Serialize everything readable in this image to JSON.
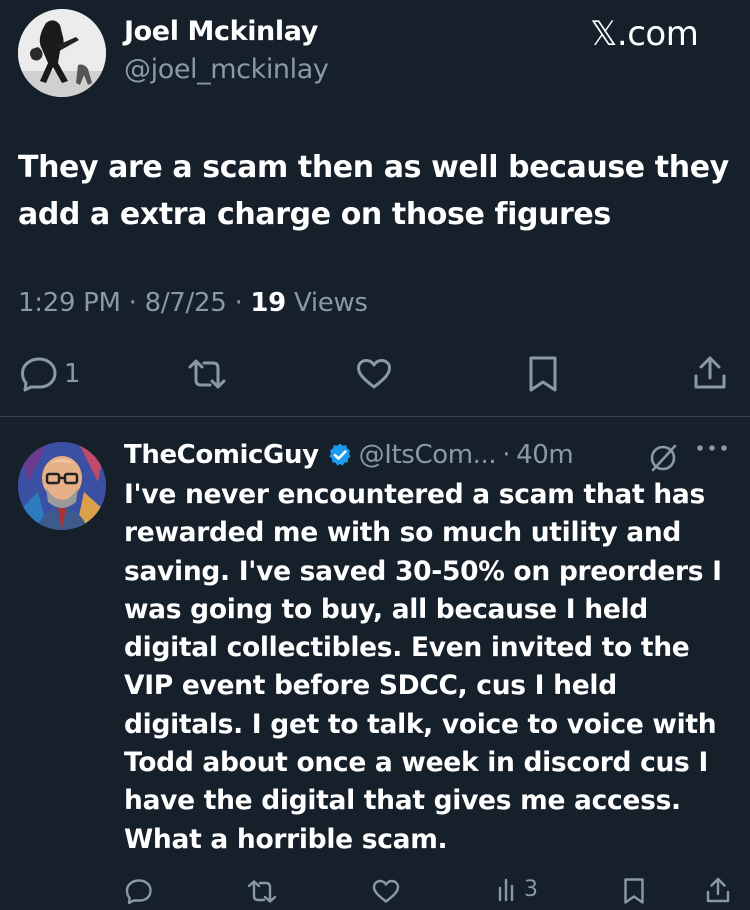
{
  "post": {
    "author_name": "Joel Mckinlay",
    "author_handle": "@joel_mckinlay",
    "brand_x": "𝕏",
    "brand_suffix": ".com",
    "text": "They are a scam then as well because they add a extra charge on those figures",
    "time": "1:29 PM",
    "date": "8/7/25",
    "views_count": "19",
    "views_label": "Views",
    "reply_count": "1",
    "icons": [
      "reply-icon",
      "repost-icon",
      "like-icon",
      "bookmark-icon",
      "share-icon"
    ]
  },
  "reply": {
    "name": "TheComicGuy",
    "handle": "@ItsCom...",
    "time": "40m",
    "text": "I've never encountered a scam that has rewarded me with so much utility and saving.  I've saved 30-50% on preorders I was going to buy, all because I held digital collectibles.  Even invited to the VIP event before SDCC, cus I held digitals.  I get to talk, voice to voice with Todd about once a week in discord cus I have the digital that gives me access.   What a horrible scam.",
    "views": "3",
    "icons": [
      "verified-icon",
      "grok-icon",
      "more-icon",
      "reply-icon",
      "repost-icon",
      "like-icon",
      "views-icon",
      "bookmark-icon",
      "share-icon"
    ]
  },
  "colors": {
    "background": "#15202b",
    "text": "#ffffff",
    "secondary": "#8b98a5",
    "divider": "#38444d",
    "verified": "#1d9bf0"
  }
}
